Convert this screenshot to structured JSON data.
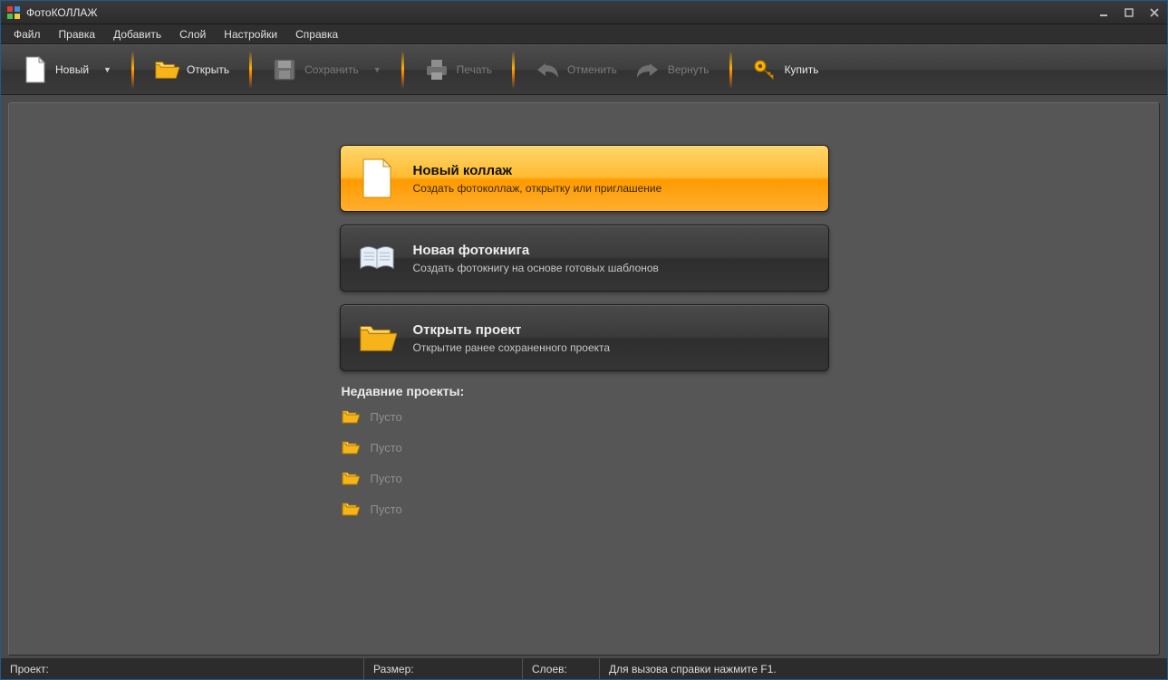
{
  "app": {
    "title": "ФотоКОЛЛАЖ"
  },
  "menu": {
    "file": "Файл",
    "edit": "Правка",
    "add": "Добавить",
    "layer": "Слой",
    "settings": "Настройки",
    "help": "Справка"
  },
  "toolbar": {
    "new": "Новый",
    "open": "Открыть",
    "save": "Сохранить",
    "print": "Печать",
    "undo": "Отменить",
    "redo": "Вернуть",
    "buy": "Купить"
  },
  "start": {
    "new_collage": {
      "title": "Новый коллаж",
      "desc": "Создать фотоколлаж, открытку или приглашение"
    },
    "new_book": {
      "title": "Новая фотокнига",
      "desc": "Создать фотокнигу на основе готовых шаблонов"
    },
    "open_proj": {
      "title": "Открыть проект",
      "desc": "Открытие ранее сохраненного проекта"
    },
    "recent_heading": "Недавние проекты:",
    "recent": [
      "Пусто",
      "Пусто",
      "Пусто",
      "Пусто"
    ]
  },
  "status": {
    "project_label": "Проект:",
    "size_label": "Размер:",
    "layers_label": "Слоев:",
    "help_hint": "Для вызова справки нажмите F1."
  }
}
